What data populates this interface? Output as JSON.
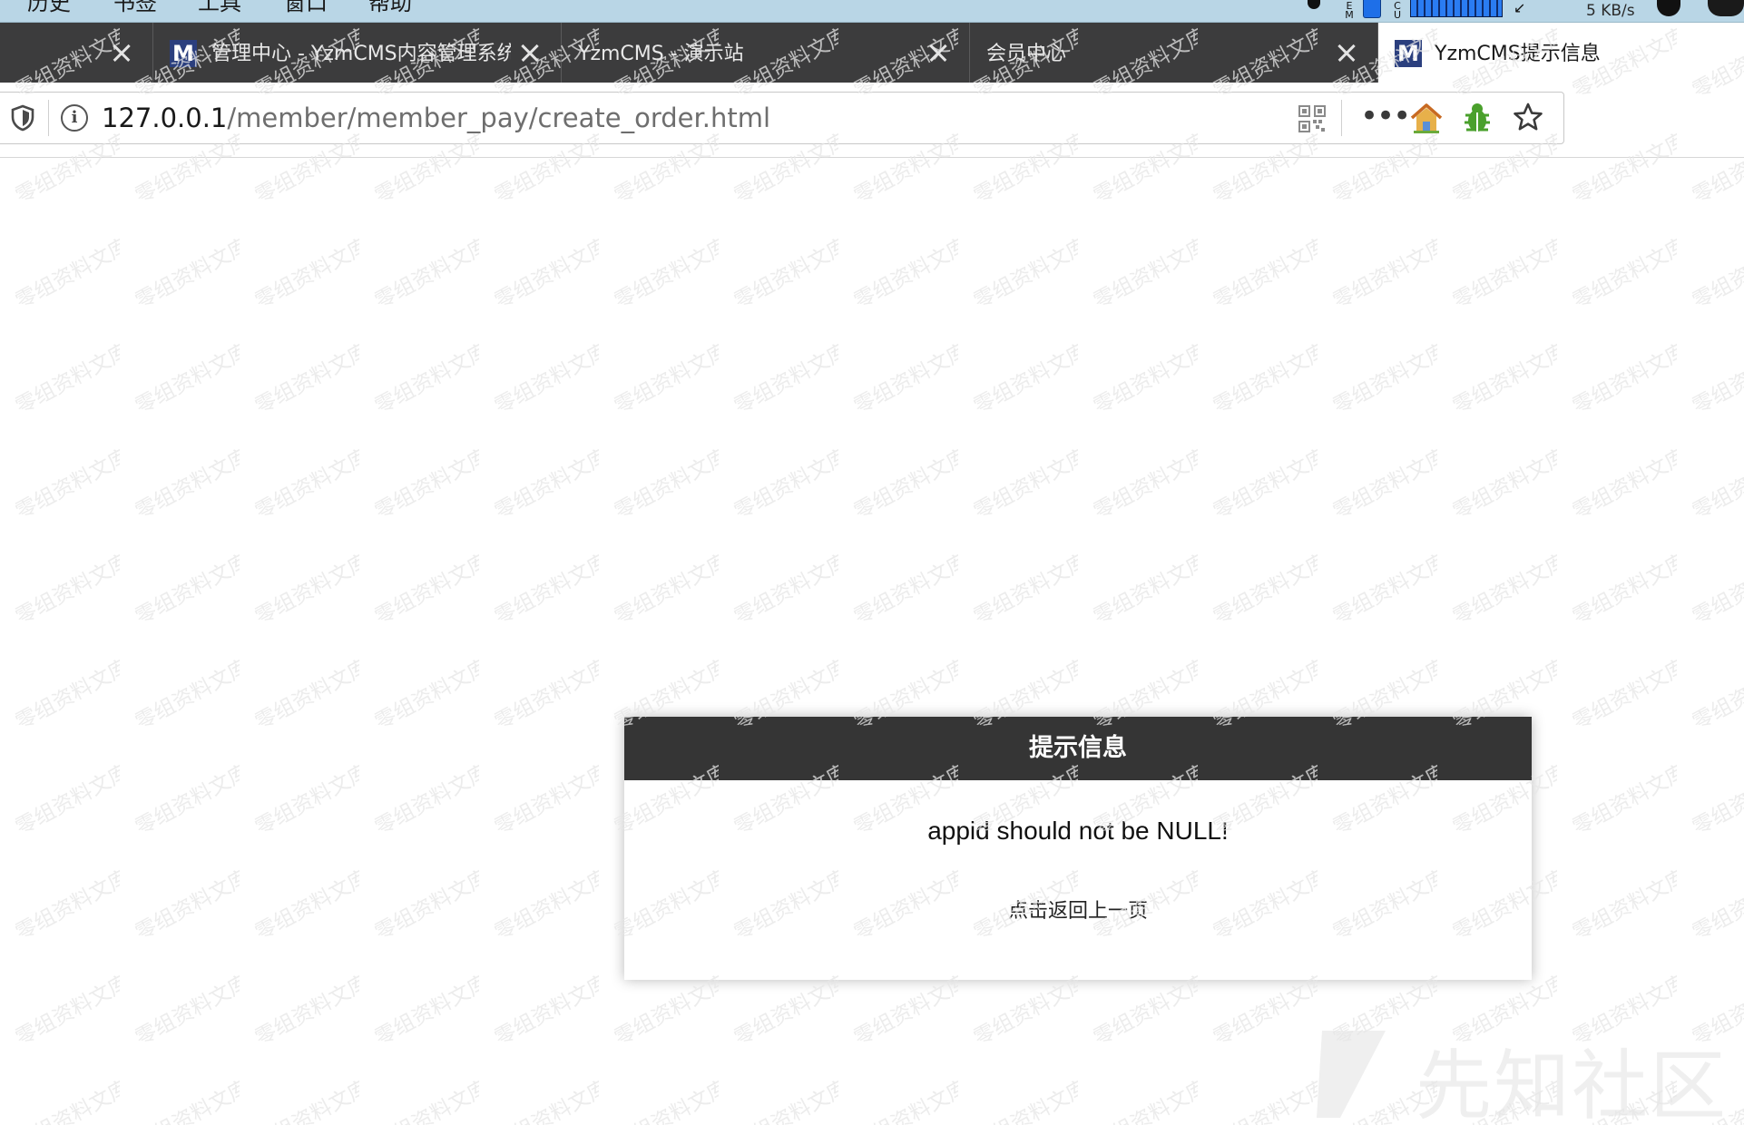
{
  "menubar": {
    "items": [
      "历史",
      "书签",
      "工具",
      "窗口",
      "帮助"
    ],
    "tray_em": "E\nM",
    "tray_cpu": "C\nU",
    "net_speed": "5 KB/s"
  },
  "tabs": [
    {
      "title": "",
      "favicon": "",
      "active": false
    },
    {
      "title": "管理中心 - YzmCMS内容管理系统",
      "favicon": "M",
      "active": false
    },
    {
      "title": "YzmCMS - 演示站",
      "favicon": "",
      "active": false
    },
    {
      "title": "会员中心",
      "favicon": "",
      "active": false
    },
    {
      "title": "YzmCMS提示信息",
      "favicon": "M",
      "active": true
    }
  ],
  "urlbar": {
    "host": "127.0.0.1",
    "path": "/member/member_pay/create_order.html"
  },
  "dialog": {
    "title": "提示信息",
    "message": "appid should not be NULL!",
    "back_link": "点击返回上一页"
  },
  "watermark": {
    "text": "零组资料文库",
    "site": "先知社区"
  },
  "colors": {
    "menubar": "#b9d6e6",
    "tabstrip": "#3c3c3d",
    "favicon": "#2b3f7e",
    "dialog_header": "#353535"
  }
}
